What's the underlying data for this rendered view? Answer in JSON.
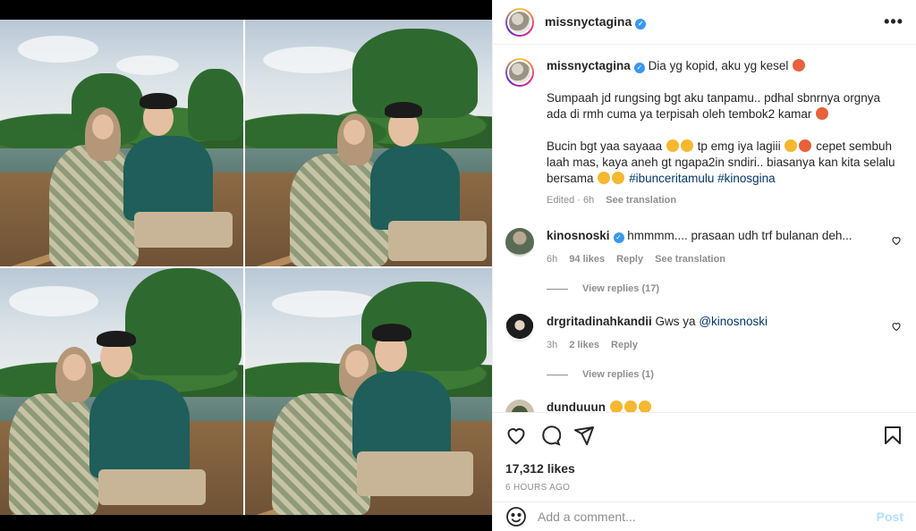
{
  "header": {
    "username": "missnyctagina",
    "more_label": "•••"
  },
  "caption": {
    "username": "missnyctagina",
    "line1": "Dia yg kopid, aku yg kesel",
    "para2": "Sumpaah jd rungsing bgt aku tanpamu.. pdhal sbnrnya orgnya ada di rmh cuma ya terpisah oleh tembok2 kamar",
    "para3_a": "Bucin bgt yaa sayaaa",
    "para3_b": "tp emg iya lagiii",
    "para3_c": "cepet sembuh laah mas, kaya aneh gt ngapa2in sndiri.. biasanya kan kita selalu bersama",
    "hashtags": "#ibunceritamulu #kinosgina",
    "edited": "Edited · 6h",
    "see_translation": "See translation"
  },
  "comments": [
    {
      "username": "kinosnoski",
      "verified": true,
      "text": "hmmmm.... prasaan udh trf bulanan deh...",
      "time": "6h",
      "likes": "94 likes",
      "reply": "Reply",
      "see_translation": "See translation",
      "view_replies": "View replies (17)"
    },
    {
      "username": "drgritadinahkandii",
      "text_prefix": "Gws ya",
      "mention": "@kinosnoski",
      "time": "3h",
      "likes": "2 likes",
      "reply": "Reply",
      "view_replies": "View replies (1)"
    },
    {
      "username": "dunduuun"
    }
  ],
  "actions": {
    "likes": "17,312 likes",
    "time": "6 HOURS AGO"
  },
  "add_comment": {
    "placeholder": "Add a comment...",
    "post_label": "Post"
  },
  "icons": [
    "more-icon",
    "verified-icon",
    "heart-icon",
    "comment-icon",
    "share-icon",
    "save-icon",
    "emoji-icon"
  ]
}
